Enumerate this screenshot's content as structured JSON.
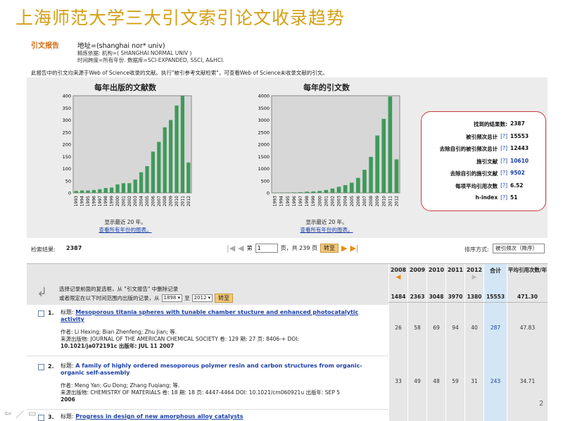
{
  "slide": {
    "title": "上海师范大学三大引文索引论文收录趋势",
    "page_number": "2"
  },
  "report": {
    "heading": "引文报告",
    "address": "地址=(shanghai nor* univ)",
    "refine": "精炼依据: 机构=( SHANGHAI NORMAL UNIV )",
    "timespan": "时间跨度=所有年份. 数据库=SCI-EXPANDED, SSCI, A&HCI.",
    "note": "此报告中的引文均来源于Web of Science收录的文献。执行\"被引参考文献检索\"，可查看Web of Science未收录文献的引文。"
  },
  "chart_data": [
    {
      "type": "bar",
      "title": "每年出版的文献数",
      "categories": [
        "1993",
        "1994",
        "1995",
        "1996",
        "1997",
        "1998",
        "1999",
        "2000",
        "2001",
        "2002",
        "2003",
        "2004",
        "2005",
        "2006",
        "2007",
        "2008",
        "2009",
        "2010",
        "2011",
        "2012"
      ],
      "values": [
        8,
        10,
        10,
        12,
        15,
        20,
        22,
        35,
        40,
        40,
        55,
        85,
        110,
        170,
        210,
        270,
        300,
        360,
        400,
        125
      ],
      "ylim": [
        0,
        400
      ],
      "yticks": [
        "0",
        "50",
        "100",
        "150",
        "200",
        "250",
        "300",
        "350",
        "400"
      ],
      "color": "#3f9a5a",
      "footnote": "显示最近 20 年。",
      "link": "查看所有年份的图表。"
    },
    {
      "type": "bar",
      "title": "每年的引文数",
      "categories": [
        "1993",
        "1994",
        "1995",
        "1996",
        "1997",
        "1998",
        "1999",
        "2000",
        "2001",
        "2002",
        "2003",
        "2004",
        "2005",
        "2006",
        "2007",
        "2008",
        "2009",
        "2010",
        "2011",
        "2012"
      ],
      "values": [
        5,
        10,
        15,
        20,
        30,
        50,
        60,
        80,
        120,
        180,
        250,
        320,
        420,
        620,
        950,
        1484,
        2363,
        3048,
        3970,
        1380
      ],
      "ylim": [
        0,
        4000
      ],
      "yticks": [
        "0",
        "500",
        "1000",
        "1500",
        "2000",
        "2500",
        "3000",
        "3500",
        "4000"
      ],
      "color": "#3f9a5a",
      "footnote": "显示最近 20 年。",
      "link": "查看所有年份的图表。"
    }
  ],
  "stats": [
    {
      "label": "找到的结果数:",
      "qm": "",
      "value": "2387",
      "link": false
    },
    {
      "label": "被引频次总计",
      "qm": "[?]",
      "value": "15553",
      "link": false
    },
    {
      "label": "去除自引的被引频次总计",
      "qm": "[?]",
      "value": "12443",
      "link": false
    },
    {
      "label": "施引文献",
      "qm": "[?]",
      "value": "10610",
      "link": true
    },
    {
      "label": "去除自引的施引文献",
      "qm": "[?]",
      "value": "9502",
      "link": true
    },
    {
      "label": "每项平均引用次数",
      "qm": "[?]",
      "value": "6.52",
      "link": false
    },
    {
      "label": "h-index",
      "qm": "[?]",
      "value": "51",
      "link": false
    }
  ],
  "pager": {
    "label": "检索结果:",
    "count": "2387",
    "page_prefix": "第",
    "page_value": "1",
    "page_suffix": "页，共 239 页",
    "go": "转至",
    "sort_label": "排序方式:",
    "sort_value": "被引频次（降序）"
  },
  "selection": {
    "line1": "选择记录前面的复选框，从 \"引文报告\" 中删除记录",
    "line2_prefix": "或者限定在以下时间范围内出版的记录，从",
    "from_year": "1898",
    "to_label": "至",
    "to_year": "2012",
    "go": "转至"
  },
  "columns": [
    {
      "head": "2008",
      "total": "1484",
      "cells": [
        "26",
        "33"
      ]
    },
    {
      "head": "2009",
      "total": "2363",
      "cells": [
        "58",
        "49"
      ]
    },
    {
      "head": "2010",
      "total": "3048",
      "cells": [
        "69",
        "48"
      ]
    },
    {
      "head": "2011",
      "total": "3970",
      "cells": [
        "94",
        "59"
      ]
    },
    {
      "head": "2012",
      "total": "1380",
      "cells": [
        "40",
        "31"
      ]
    },
    {
      "head": "合计",
      "total": "15553",
      "cells": [
        "287",
        "243"
      ]
    },
    {
      "head": "平均引用次数/年",
      "total": "471.30",
      "cells": [
        "47.83",
        "34.71"
      ]
    }
  ],
  "records": [
    {
      "num": "1.",
      "title_label": "标题:",
      "title": "Mesoporous titania spheres with tunable chamber stucture and enhanced photocatalytic activity",
      "authors": "作者: Li Hexing; Bian Zhenfeng; Zhu Jian; 等.",
      "source": "来源出版物: JOURNAL OF THE AMERICAN CHEMICAL SOCIETY 卷: 129  期: 27  页: 8406-+  DOI:",
      "doi": "10.1021/ja072191c  出版年: JUL 11 2007"
    },
    {
      "num": "2.",
      "title_label": "标题:",
      "title": "A family of highly ordered mesoporous polymer resin and carbon structures from organic-organic self-assembly",
      "authors": "作者: Meng Yan; Gu Dong; Zhang Fuqiang; 等.",
      "source": "来源出版物: CHEMISTRY OF MATERIALS 卷: 18  期: 18  页: 4447-4464  DOI: 10.1021/cm060921u  出版年: SEP 5",
      "doi": "2006"
    },
    {
      "num": "3.",
      "title_label": "标题:",
      "title": "Progress in design of new amorphous alloy catalysts",
      "authors": "",
      "source": "",
      "doi": ""
    }
  ]
}
